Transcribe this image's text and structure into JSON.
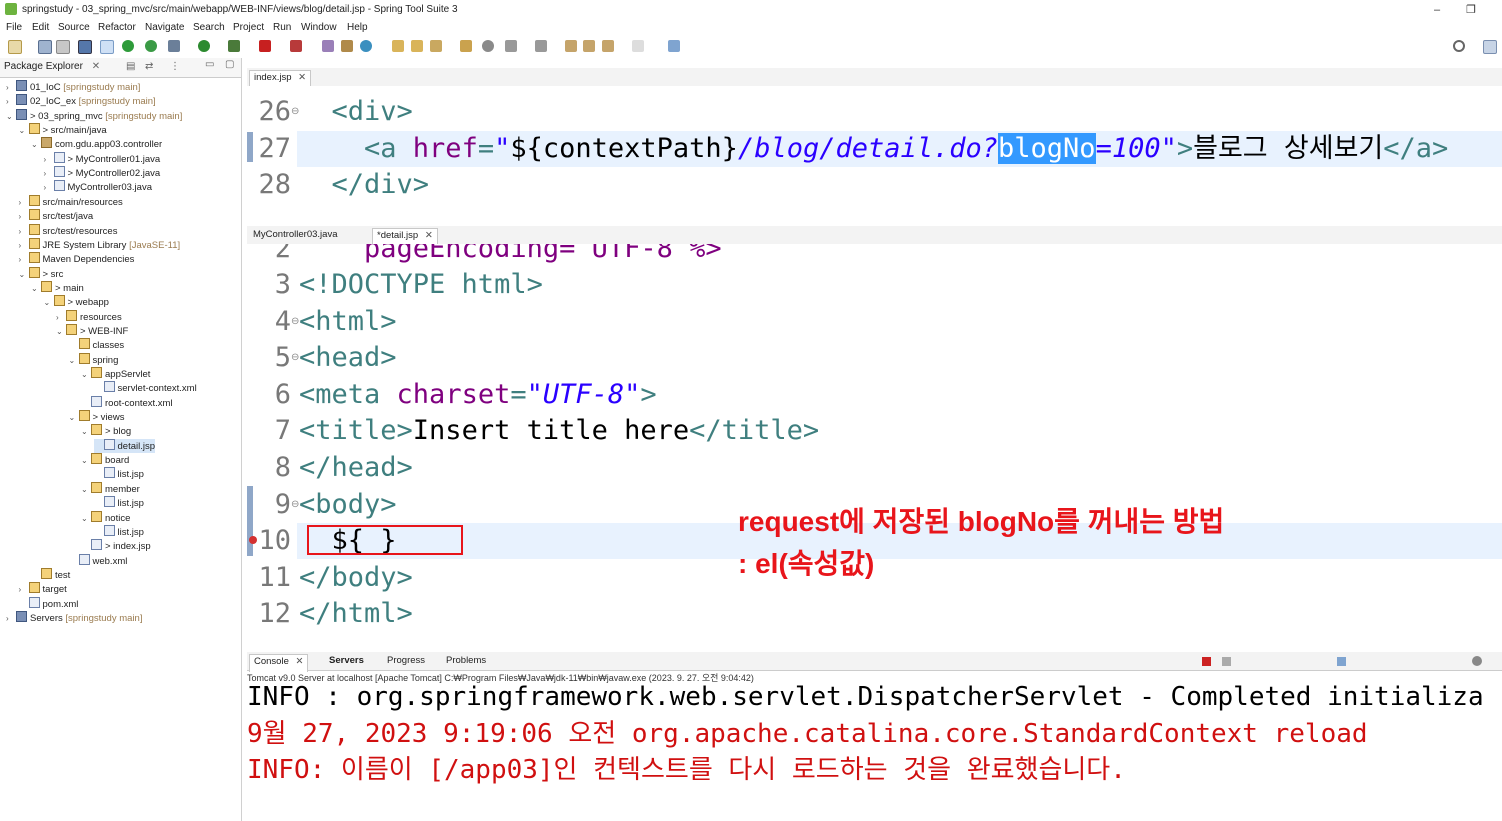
{
  "window": {
    "title": "springstudy - 03_spring_mvc/src/main/webapp/WEB-INF/views/blog/detail.jsp - Spring Tool Suite 3",
    "minimize": "–",
    "restore": "❐",
    "close": "✕"
  },
  "menu": [
    "File",
    "Edit",
    "Source",
    "Refactor",
    "Navigate",
    "Search",
    "Project",
    "Run",
    "Window",
    "Help"
  ],
  "package_explorer": {
    "tab_label": "Package Explorer",
    "tree": [
      {
        "text": "01_IoC",
        "dim": " [springstudy main]",
        "indent": 0,
        "arrow": ">",
        "icon": "proj"
      },
      {
        "text": "02_IoC_ex",
        "dim": " [springstudy main]",
        "indent": 0,
        "arrow": ">",
        "icon": "proj"
      },
      {
        "text": "> 03_spring_mvc",
        "dim": " [springstudy main]",
        "indent": 0,
        "arrow": "v",
        "icon": "proj"
      },
      {
        "text": "> src/main/java",
        "dim": "",
        "indent": 1,
        "arrow": "v",
        "icon": "folder"
      },
      {
        "text": "com.gdu.app03.controller",
        "dim": "",
        "indent": 2,
        "arrow": "v",
        "icon": "pkg"
      },
      {
        "text": "> MyController01.java",
        "dim": "",
        "indent": 3,
        "arrow": ">",
        "icon": "file"
      },
      {
        "text": "> MyController02.java",
        "dim": "",
        "indent": 3,
        "arrow": ">",
        "icon": "file"
      },
      {
        "text": "MyController03.java",
        "dim": "",
        "indent": 3,
        "arrow": ">",
        "icon": "file"
      },
      {
        "text": "src/main/resources",
        "dim": "",
        "indent": 1,
        "arrow": ">",
        "icon": "folder"
      },
      {
        "text": "src/test/java",
        "dim": "",
        "indent": 1,
        "arrow": ">",
        "icon": "folder"
      },
      {
        "text": "src/test/resources",
        "dim": "",
        "indent": 1,
        "arrow": ">",
        "icon": "folder"
      },
      {
        "text": "JRE System Library",
        "dim": " [JavaSE-11]",
        "indent": 1,
        "arrow": ">",
        "icon": "folder"
      },
      {
        "text": "Maven Dependencies",
        "dim": "",
        "indent": 1,
        "arrow": ">",
        "icon": "folder"
      },
      {
        "text": "> src",
        "dim": "",
        "indent": 1,
        "arrow": "v",
        "icon": "folder"
      },
      {
        "text": "> main",
        "dim": "",
        "indent": 2,
        "arrow": "v",
        "icon": "folder"
      },
      {
        "text": "> webapp",
        "dim": "",
        "indent": 3,
        "arrow": "v",
        "icon": "folder"
      },
      {
        "text": "resources",
        "dim": "",
        "indent": 4,
        "arrow": ">",
        "icon": "folder"
      },
      {
        "text": "> WEB-INF",
        "dim": "",
        "indent": 4,
        "arrow": "v",
        "icon": "folder"
      },
      {
        "text": "classes",
        "dim": "",
        "indent": 5,
        "arrow": "",
        "icon": "folder"
      },
      {
        "text": "spring",
        "dim": "",
        "indent": 5,
        "arrow": "v",
        "icon": "folder"
      },
      {
        "text": "appServlet",
        "dim": "",
        "indent": 6,
        "arrow": "v",
        "icon": "folder"
      },
      {
        "text": "servlet-context.xml",
        "dim": "",
        "indent": 7,
        "arrow": "",
        "icon": "file"
      },
      {
        "text": "root-context.xml",
        "dim": "",
        "indent": 6,
        "arrow": "",
        "icon": "file"
      },
      {
        "text": "> views",
        "dim": "",
        "indent": 5,
        "arrow": "v",
        "icon": "folder"
      },
      {
        "text": "> blog",
        "dim": "",
        "indent": 6,
        "arrow": "v",
        "icon": "folder"
      },
      {
        "text": "detail.jsp",
        "dim": "",
        "indent": 7,
        "arrow": "",
        "icon": "file",
        "selected": true
      },
      {
        "text": "board",
        "dim": "",
        "indent": 6,
        "arrow": "v",
        "icon": "folder"
      },
      {
        "text": "list.jsp",
        "dim": "",
        "indent": 7,
        "arrow": "",
        "icon": "file"
      },
      {
        "text": "member",
        "dim": "",
        "indent": 6,
        "arrow": "v",
        "icon": "folder"
      },
      {
        "text": "list.jsp",
        "dim": "",
        "indent": 7,
        "arrow": "",
        "icon": "file"
      },
      {
        "text": "notice",
        "dim": "",
        "indent": 6,
        "arrow": "v",
        "icon": "folder"
      },
      {
        "text": "list.jsp",
        "dim": "",
        "indent": 7,
        "arrow": "",
        "icon": "file"
      },
      {
        "text": "> index.jsp",
        "dim": "",
        "indent": 6,
        "arrow": "",
        "icon": "file"
      },
      {
        "text": "web.xml",
        "dim": "",
        "indent": 5,
        "arrow": "",
        "icon": "file"
      },
      {
        "text": "test",
        "dim": "",
        "indent": 2,
        "arrow": "",
        "icon": "folder"
      },
      {
        "text": "target",
        "dim": "",
        "indent": 1,
        "arrow": ">",
        "icon": "folder"
      },
      {
        "text": "pom.xml",
        "dim": "",
        "indent": 1,
        "arrow": "",
        "icon": "file"
      },
      {
        "text": "Servers",
        "dim": " [springstudy main]",
        "indent": 0,
        "arrow": ">",
        "icon": "proj"
      }
    ]
  },
  "editor_top": {
    "tab": "index.jsp",
    "lines": [
      {
        "num": "26",
        "marker": "⊖",
        "parts": [
          [
            "tag",
            "  <div>"
          ]
        ]
      },
      {
        "num": "27",
        "marker": "",
        "current": true,
        "parts": [
          [
            "tag",
            "    <a "
          ],
          [
            "attr",
            "href"
          ],
          [
            "tag",
            "="
          ],
          [
            "str",
            "\""
          ],
          [
            "txt",
            "${contextPath}"
          ],
          [
            "str",
            "/blog/detail.do?"
          ],
          [
            "hl",
            "blogNo"
          ],
          [
            "str",
            "=100\""
          ],
          [
            "tag",
            ">"
          ],
          [
            "txt",
            "블로그 상세보기"
          ],
          [
            "tag",
            "</a>"
          ]
        ]
      },
      {
        "num": "28",
        "marker": "",
        "parts": [
          [
            "tag",
            "  </div>"
          ]
        ]
      }
    ]
  },
  "editor_bottom": {
    "tabs": [
      "MyController03.java",
      "*detail.jsp"
    ],
    "partial_first": "    pageEncoding= UTF-8 %>",
    "partial_num": "2",
    "lines": [
      {
        "num": "3",
        "marker": "",
        "parts": [
          [
            "tag",
            "<!DOCTYPE html>"
          ]
        ]
      },
      {
        "num": "4",
        "marker": "⊖",
        "parts": [
          [
            "tag",
            "<html>"
          ]
        ]
      },
      {
        "num": "5",
        "marker": "⊖",
        "parts": [
          [
            "tag",
            "<head>"
          ]
        ]
      },
      {
        "num": "6",
        "marker": "",
        "parts": [
          [
            "tag",
            "<meta "
          ],
          [
            "attr",
            "charset"
          ],
          [
            "tag",
            "="
          ],
          [
            "str",
            "\"UTF-8\""
          ],
          [
            "tag",
            ">"
          ]
        ]
      },
      {
        "num": "7",
        "marker": "",
        "parts": [
          [
            "tag",
            "<title>"
          ],
          [
            "txt",
            "Insert title here"
          ],
          [
            "tag",
            "</title>"
          ]
        ]
      },
      {
        "num": "8",
        "marker": "",
        "parts": [
          [
            "tag",
            "</head>"
          ]
        ]
      },
      {
        "num": "9",
        "marker": "⊖",
        "parts": [
          [
            "tag",
            "<body>"
          ]
        ]
      },
      {
        "num": "10",
        "marker": "",
        "current": true,
        "parts": [
          [
            "txt",
            "  ${ }"
          ]
        ]
      },
      {
        "num": "11",
        "marker": "",
        "parts": [
          [
            "tag",
            "</body>"
          ]
        ]
      },
      {
        "num": "12",
        "marker": "",
        "parts": [
          [
            "tag",
            "</html>"
          ]
        ]
      }
    ]
  },
  "annotation": {
    "line1": "request에 저장된 blogNo를 꺼내는 방법",
    "line2": ": el(속성값)"
  },
  "console": {
    "tabs": [
      "Console",
      "Servers",
      "Progress",
      "Problems"
    ],
    "header": "Tomcat v9.0 Server at localhost [Apache Tomcat] C:₩Program Files₩Java₩jdk-11₩bin₩javaw.exe  (2023. 9. 27. 오전 9:04:42)",
    "lines": [
      {
        "text": "INFO : org.springframework.web.servlet.DispatcherServlet - Completed initializa",
        "color": "#000000"
      },
      {
        "text": "9월 27, 2023 9:19:06 오전 org.apache.catalina.core.StandardContext reload",
        "color": "#d01010"
      },
      {
        "text": "INFO: 이름이 [/app03]인 컨텍스트를 다시 로드하는 것을 완료했습니다.",
        "color": "#d01010"
      }
    ]
  },
  "colors": {
    "tag": "#3f7f7f",
    "attr": "#7f007f",
    "string": "#2a00ff",
    "annotation_red": "#e8151b",
    "selection": "#3399ff"
  }
}
